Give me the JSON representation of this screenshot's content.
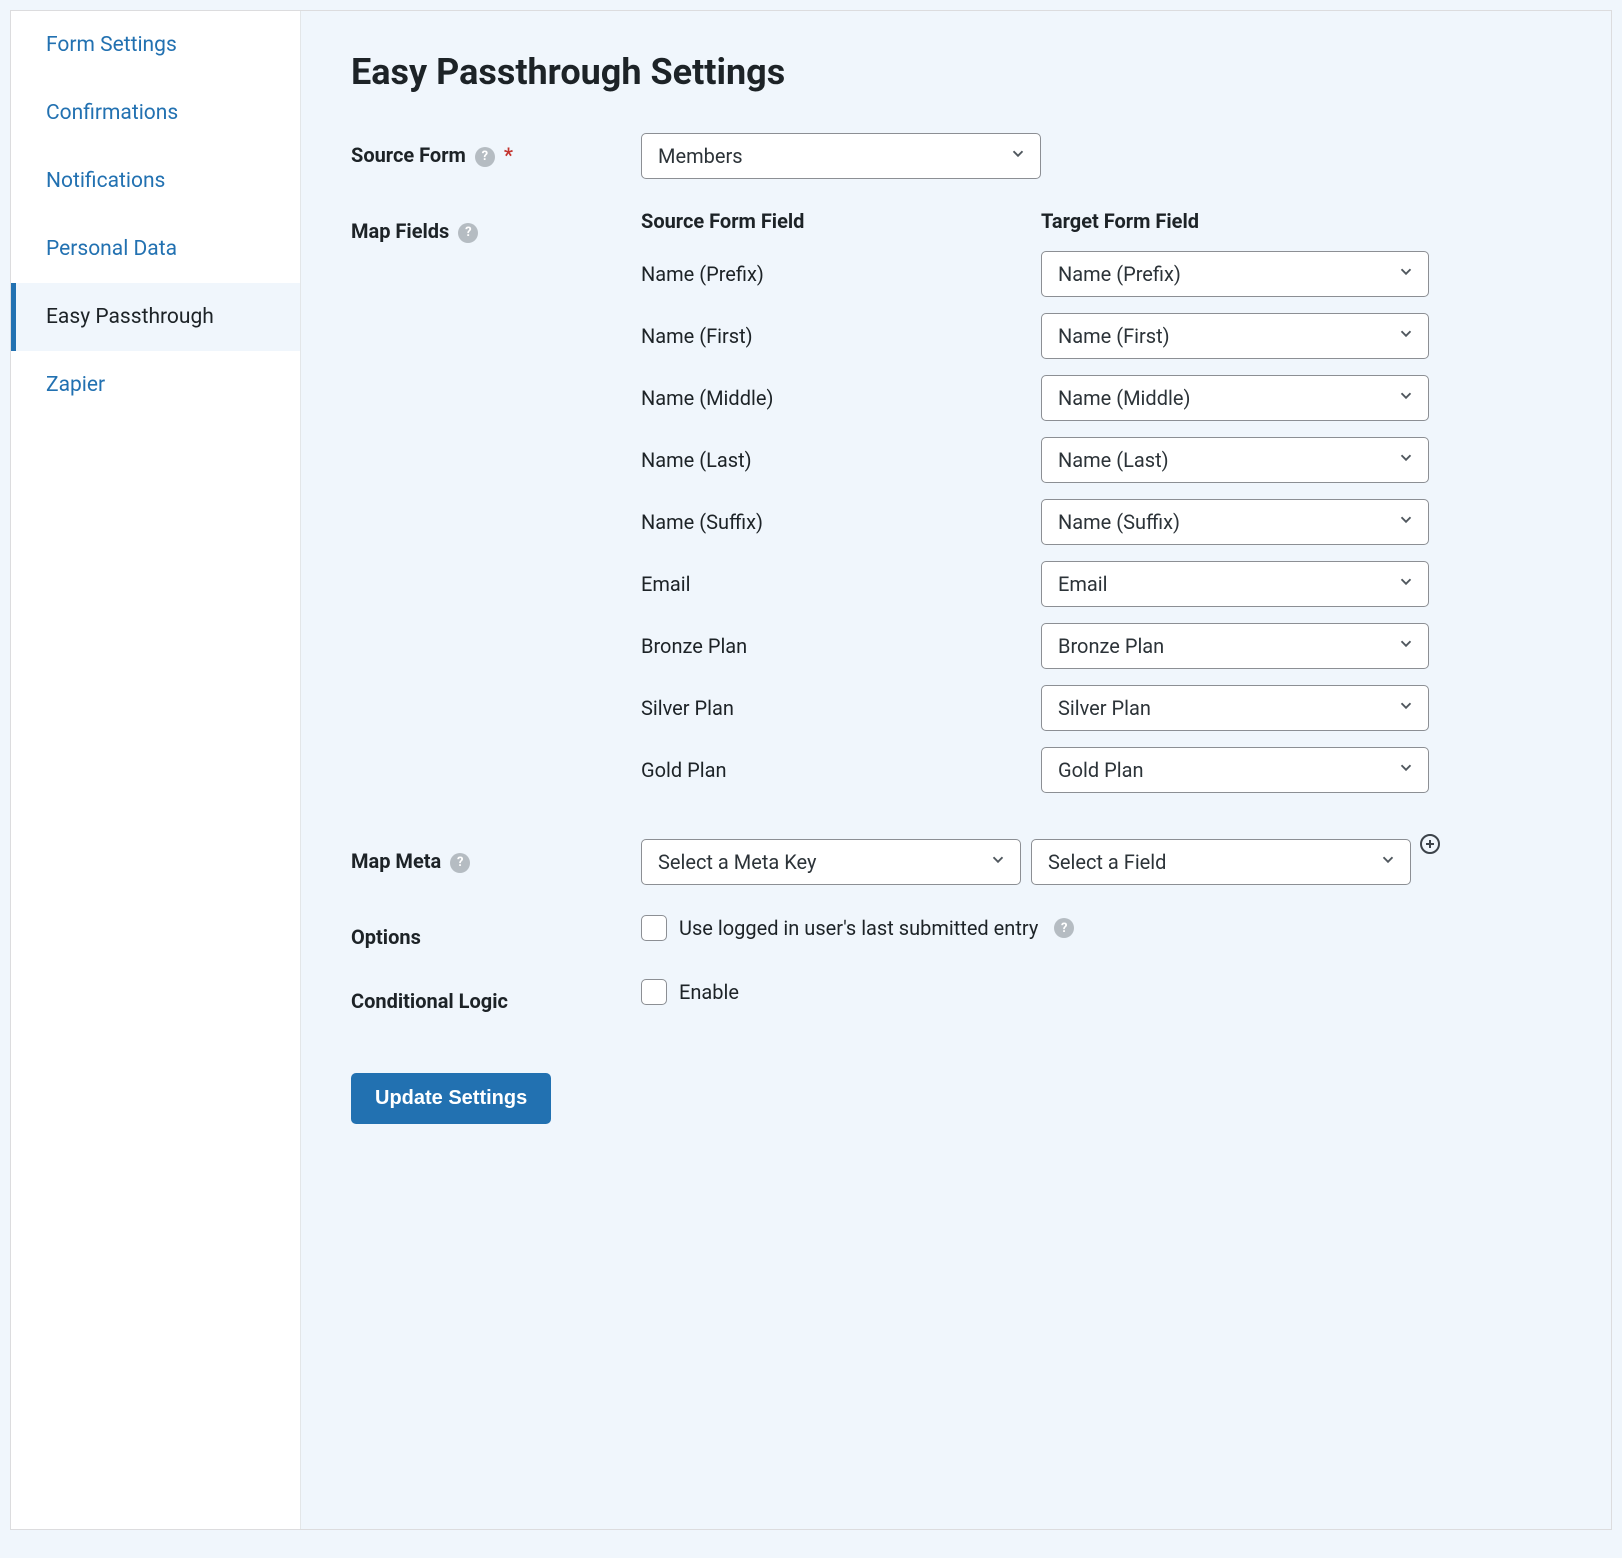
{
  "sidebar": {
    "items": [
      {
        "label": "Form Settings",
        "active": false
      },
      {
        "label": "Confirmations",
        "active": false
      },
      {
        "label": "Notifications",
        "active": false
      },
      {
        "label": "Personal Data",
        "active": false
      },
      {
        "label": "Easy Passthrough",
        "active": true
      },
      {
        "label": "Zapier",
        "active": false
      }
    ]
  },
  "page": {
    "title": "Easy Passthrough Settings"
  },
  "source_form": {
    "label": "Source Form",
    "value": "Members",
    "required": "*"
  },
  "map_fields": {
    "label": "Map Fields",
    "header_source": "Source Form Field",
    "header_target": "Target Form Field",
    "rows": [
      {
        "source": "Name (Prefix)",
        "target": "Name (Prefix)"
      },
      {
        "source": "Name (First)",
        "target": "Name (First)"
      },
      {
        "source": "Name (Middle)",
        "target": "Name (Middle)"
      },
      {
        "source": "Name (Last)",
        "target": "Name (Last)"
      },
      {
        "source": "Name (Suffix)",
        "target": "Name (Suffix)"
      },
      {
        "source": "Email",
        "target": "Email"
      },
      {
        "source": "Bronze Plan",
        "target": "Bronze Plan"
      },
      {
        "source": "Silver Plan",
        "target": "Silver Plan"
      },
      {
        "source": "Gold Plan",
        "target": "Gold Plan"
      }
    ]
  },
  "map_meta": {
    "label": "Map Meta",
    "meta_key_placeholder": "Select a Meta Key",
    "field_placeholder": "Select a Field"
  },
  "options": {
    "label": "Options",
    "checkbox_label": "Use logged in user's last submitted entry"
  },
  "conditional_logic": {
    "label": "Conditional Logic",
    "checkbox_label": "Enable"
  },
  "buttons": {
    "update": "Update Settings"
  }
}
